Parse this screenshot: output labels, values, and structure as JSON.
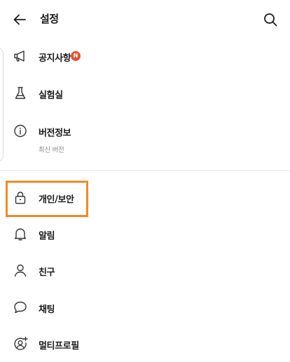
{
  "header": {
    "title": "설정",
    "back_icon": "arrow-left-icon",
    "search_icon": "search-icon"
  },
  "menu": {
    "notices": {
      "label": "공지사항",
      "icon": "megaphone-icon",
      "badge": "N"
    },
    "lab": {
      "label": "실험실",
      "icon": "flask-icon"
    },
    "version": {
      "label": "버전정보",
      "sublabel": "최신 버전",
      "icon": "info-icon"
    },
    "privacy": {
      "label": "개인/보안",
      "icon": "lock-icon"
    },
    "notifications": {
      "label": "알림",
      "icon": "bell-icon"
    },
    "friends": {
      "label": "친구",
      "icon": "person-icon"
    },
    "chat": {
      "label": "채팅",
      "icon": "chat-bubble-icon"
    },
    "multiprofile": {
      "label": "멀티프로필",
      "icon": "add-profile-icon"
    }
  },
  "colors": {
    "highlight": "#f08b26",
    "badge": "#e2542e",
    "text": "#1a1a1a",
    "subtext": "#8a8a8a"
  }
}
